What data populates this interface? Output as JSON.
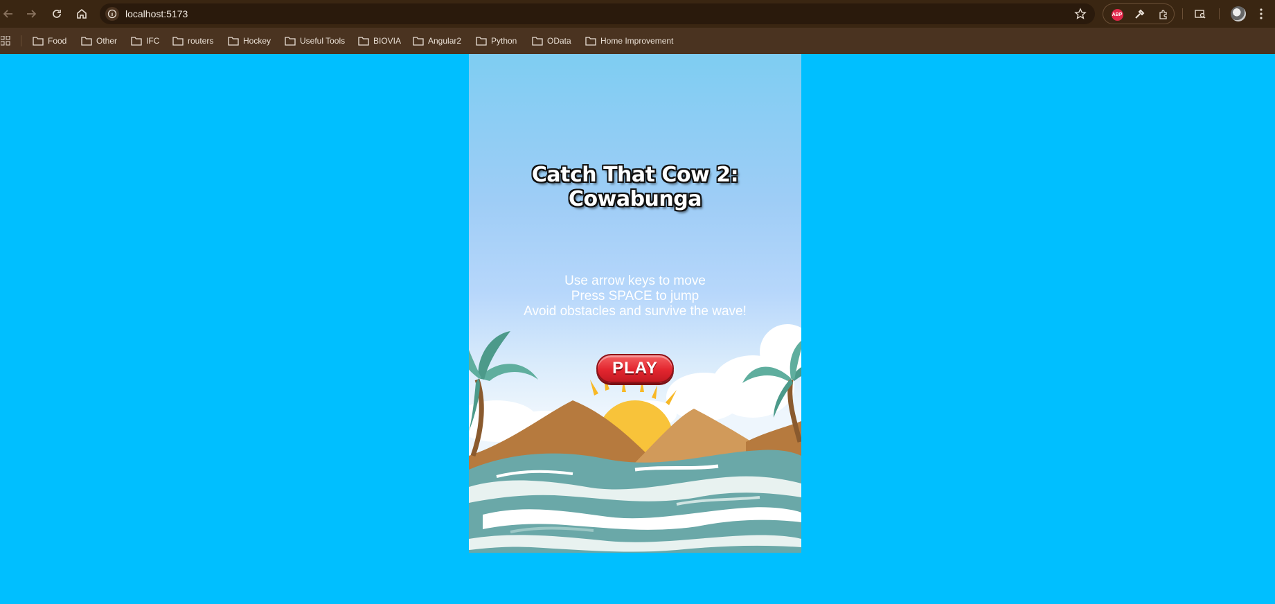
{
  "browser": {
    "url": "localhost:5173",
    "bookmarks": [
      "Food",
      "Other",
      "IFC",
      "routers",
      "Hockey",
      "Useful Tools",
      "BIOVIA",
      "Angular2",
      "Python",
      "OData",
      "Home Improvement"
    ],
    "extensions": {
      "abp_label": "ABP"
    }
  },
  "game": {
    "title": "Catch That Cow 2: Cowabunga",
    "instructions": [
      "Use arrow keys to move",
      "Press SPACE to jump",
      "Avoid obstacles and survive the wave!"
    ],
    "play_label": "PLAY"
  },
  "colors": {
    "page_background": "#00bfff",
    "toolbar": "#3a2612",
    "bookmarks_bar": "#4a3320",
    "play_button": "#e3262f",
    "water": "#6aa8a8",
    "sun": "#f8c33a"
  },
  "icons": [
    "back-icon",
    "forward-icon",
    "reload-icon",
    "home-icon",
    "site-info-icon",
    "bookmark-star-icon",
    "adblock-icon",
    "eyedropper-icon",
    "extensions-icon",
    "tab-search-icon",
    "avatar",
    "menu-icon",
    "apps-icon",
    "folder-icon"
  ]
}
